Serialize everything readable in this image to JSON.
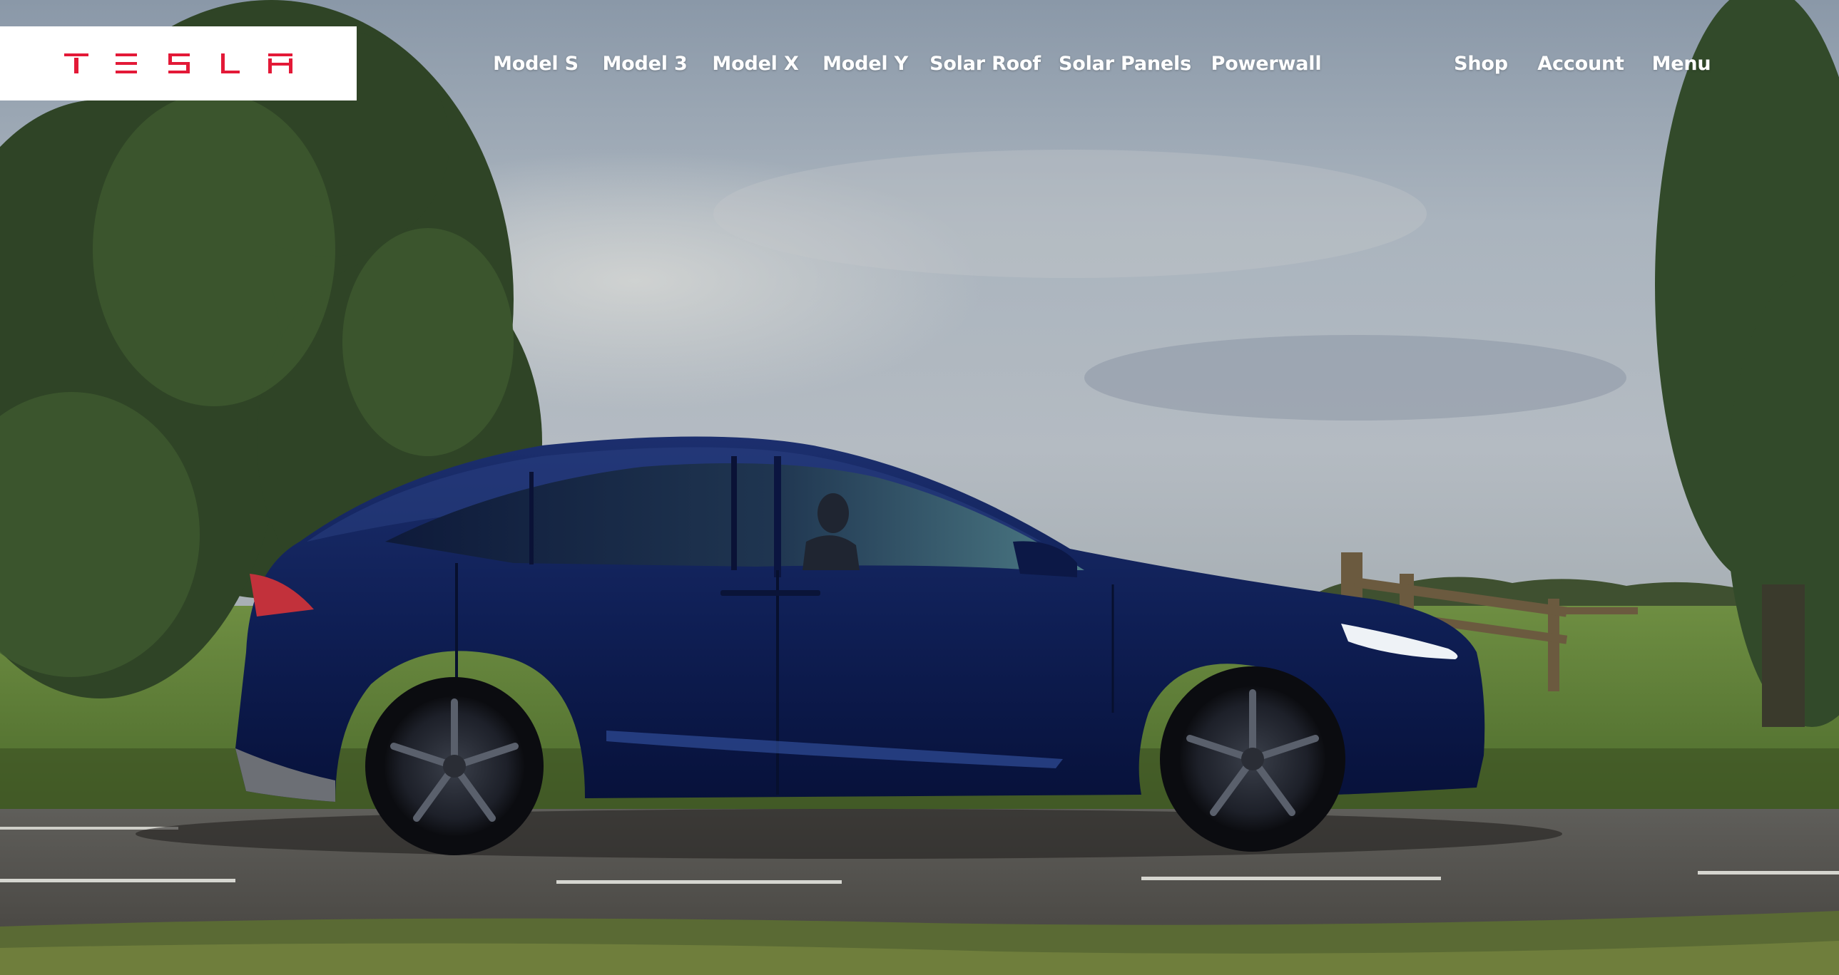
{
  "brand": {
    "logo_text": "TESLA",
    "logo_color": "#e31937"
  },
  "nav": {
    "main": [
      {
        "label": "Model S"
      },
      {
        "label": "Model 3"
      },
      {
        "label": "Model X"
      },
      {
        "label": "Model Y"
      },
      {
        "label": "Solar Roof"
      },
      {
        "label": "Solar Panels"
      },
      {
        "label": "Powerwall"
      }
    ],
    "right": [
      {
        "label": "Shop"
      },
      {
        "label": "Account"
      },
      {
        "label": "Menu"
      }
    ]
  },
  "hero": {
    "subject": "Model X",
    "car_color": "#0d1d52"
  }
}
